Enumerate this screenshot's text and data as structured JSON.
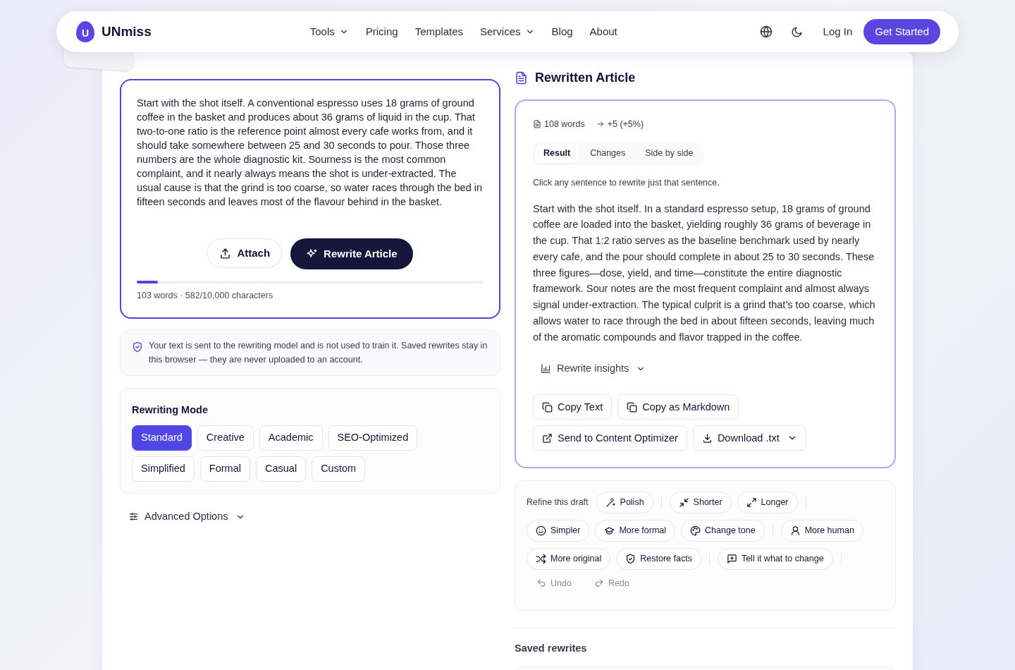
{
  "nav": {
    "logo_letter": "U",
    "brand": "UNmiss",
    "links": [
      {
        "label": "Tools",
        "dropdown": true
      },
      {
        "label": "Pricing",
        "dropdown": false
      },
      {
        "label": "Templates",
        "dropdown": false
      },
      {
        "label": "Services",
        "dropdown": true
      },
      {
        "label": "Blog",
        "dropdown": false
      },
      {
        "label": "About",
        "dropdown": false
      }
    ],
    "login": "Log In",
    "cta": "Get Started"
  },
  "editor": {
    "value": "Start with the shot itself. A conventional espresso uses 18 grams of ground coffee in the basket and produces about 36 grams of liquid in the cup. That two-to-one ratio is the reference point almost every cafe works from, and it should take somewhere between 25 and 30 seconds to pour. Those three numbers are the whole diagnostic kit. Sourness is the most common complaint, and it nearly always means the shot is under-extracted. The usual cause is that the grind is too coarse, so water races through the bed in fifteen seconds and leaves most of the flavour behind in the basket.",
    "attach": "Attach",
    "rewrite": "Rewrite Article",
    "level": 0.06,
    "count": "103 words · 582/10,000 characters"
  },
  "privacy": "Your text is sent to the rewriting model and is not used to train it. Saved rewrites stay in this browser — they are never uploaded to an account.",
  "modes": {
    "title": "Rewriting Mode",
    "items": [
      {
        "label": "Standard",
        "selected": true
      },
      {
        "label": "Creative",
        "selected": false
      },
      {
        "label": "Academic",
        "selected": false
      },
      {
        "label": "SEO-Optimized",
        "selected": false
      },
      {
        "label": "Simplified",
        "selected": false
      },
      {
        "label": "Formal",
        "selected": false
      },
      {
        "label": "Casual",
        "selected": false
      },
      {
        "label": "Custom",
        "selected": false
      }
    ]
  },
  "advanced": "Advanced Options",
  "result": {
    "title": "Rewritten Article",
    "words": "108 words",
    "delta": "+5 (+5%)",
    "tabs": [
      {
        "label": "Result",
        "selected": true
      },
      {
        "label": "Changes",
        "selected": false
      },
      {
        "label": "Side by side",
        "selected": false
      }
    ],
    "hint": "Click any sentence to rewrite just that sentence.",
    "text": "Start with the shot itself. In a standard espresso setup, 18 grams of ground coffee are loaded into the basket, yielding roughly 36 grams of beverage in the cup. That 1:2 ratio serves as the baseline benchmark used by nearly every cafe, and the pour should complete in about 25 to 30 seconds. These three figures—dose, yield, and time—constitute the entire diagnostic framework. Sour notes are the most frequent complaint and almost always signal under-extraction. The typical culprit is a grind that’s too coarse, which allows water to race through the bed in about fifteen seconds, leaving much of the aromatic compounds and flavor trapped in the coffee.",
    "insights": "Rewrite insights",
    "actions": [
      [
        "Copy Text",
        "Copy as Markdown"
      ],
      [
        "Send to Content Optimizer",
        "Download .txt"
      ]
    ]
  },
  "refine": {
    "label": "Refine this draft",
    "rows": [
      [
        {
          "kind": "chip",
          "label": "Polish"
        },
        {
          "kind": "divider"
        },
        {
          "kind": "chip",
          "label": "Shorter"
        },
        {
          "kind": "chip",
          "label": "Longer"
        },
        {
          "kind": "divider"
        }
      ],
      [
        {
          "kind": "chip",
          "label": "Simpler"
        },
        {
          "kind": "chip",
          "label": "More formal"
        },
        {
          "kind": "chip",
          "label": "Change tone"
        },
        {
          "kind": "divider"
        },
        {
          "kind": "chip",
          "label": "More human"
        }
      ],
      [
        {
          "kind": "chip",
          "label": "More original"
        },
        {
          "kind": "chip",
          "label": "Restore facts"
        },
        {
          "kind": "divider"
        },
        {
          "kind": "chip",
          "label": "Tell it what to change"
        },
        {
          "kind": "divider"
        }
      ]
    ],
    "history": [
      {
        "label": "Undo",
        "disabled": true
      },
      {
        "label": "Redo",
        "disabled": true
      }
    ]
  },
  "saved_title": "Saved rewrites"
}
